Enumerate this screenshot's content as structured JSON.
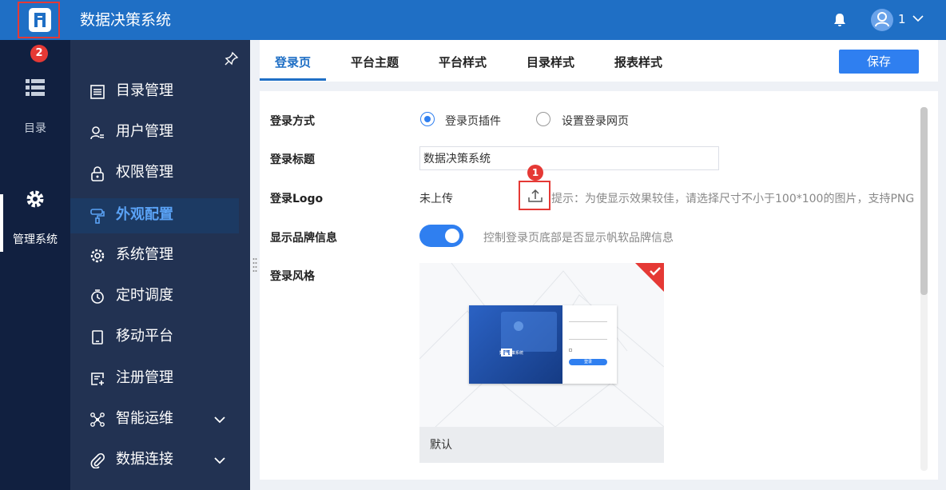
{
  "app": {
    "title": "数据决策系统"
  },
  "header": {
    "username": "1"
  },
  "badges": {
    "logo_badge": "2",
    "upload_badge": "1"
  },
  "rail": {
    "items": [
      {
        "label": "目录",
        "icon": "list-icon"
      },
      {
        "label": "管理系统",
        "icon": "gear-icon"
      }
    ]
  },
  "nav": {
    "items": [
      {
        "label": "目录管理",
        "icon": "catalog-icon"
      },
      {
        "label": "用户管理",
        "icon": "user-manage-icon"
      },
      {
        "label": "权限管理",
        "icon": "lock-icon"
      },
      {
        "label": "外观配置",
        "icon": "paint-roller-icon",
        "active": true
      },
      {
        "label": "系统管理",
        "icon": "settings-icon"
      },
      {
        "label": "定时调度",
        "icon": "timer-icon"
      },
      {
        "label": "移动平台",
        "icon": "tablet-icon"
      },
      {
        "label": "注册管理",
        "icon": "register-icon"
      },
      {
        "label": "智能运维",
        "icon": "nodes-icon",
        "expandable": true
      },
      {
        "label": "数据连接",
        "icon": "paperclip-icon",
        "expandable": true
      }
    ]
  },
  "tabs": [
    "登录页",
    "平台主题",
    "平台样式",
    "目录样式",
    "报表样式"
  ],
  "toolbar": {
    "save_label": "保存"
  },
  "form": {
    "login_method": {
      "label": "登录方式",
      "options": [
        "登录页插件",
        "设置登录网页"
      ],
      "selected": "登录页插件"
    },
    "login_title": {
      "label": "登录标题",
      "value": "数据决策系统"
    },
    "login_logo": {
      "label": "登录Logo",
      "status": "未上传",
      "hint": "提示：为使显示效果较佳，请选择尺寸不小于100*100的图片，支持PNG"
    },
    "brand_info": {
      "label": "显示品牌信息",
      "enabled": true,
      "description": "控制登录页底部是否显示帆软品牌信息"
    },
    "login_style": {
      "label": "登录风格",
      "selected_style": "默认"
    }
  },
  "preview": {
    "title": "数据决策系统",
    "login_button": "登录"
  },
  "colors": {
    "header": "#1f6fc5",
    "rail": "#112040",
    "nav": "#223252",
    "accent": "#2f7ff0",
    "annotation": "#e53935"
  }
}
